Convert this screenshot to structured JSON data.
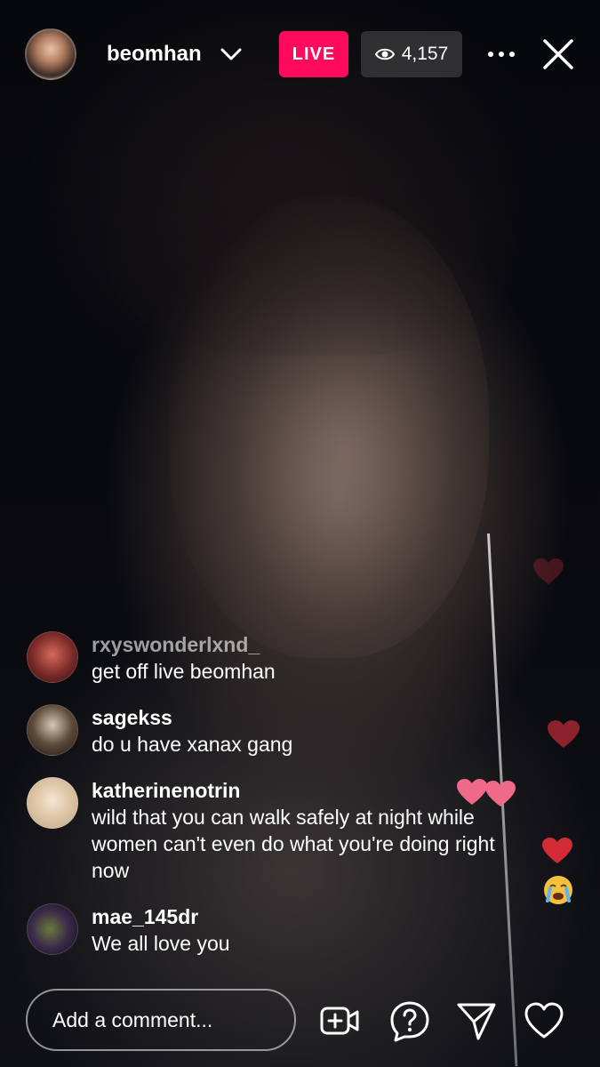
{
  "header": {
    "username": "beomhan",
    "live_label": "LIVE",
    "viewer_count": "4,157"
  },
  "comments": [
    {
      "username": "rxyswonderlxnd_",
      "text": "get off live beomhan"
    },
    {
      "username": "sagekss",
      "text": "do u have xanax gang"
    },
    {
      "username": "katherinenotrin",
      "text": "wild that you can walk safely at night while women can't even do what you're doing right now"
    },
    {
      "username": "mae_145dr",
      "text": "We all love you"
    }
  ],
  "reactions": [
    "heart",
    "heart",
    "heart",
    "heart",
    "heart",
    "crying-face"
  ],
  "footer": {
    "comment_placeholder": "Add a comment..."
  },
  "colors": {
    "live_badge": "#ff0a5c",
    "heart": "#e0334a"
  }
}
